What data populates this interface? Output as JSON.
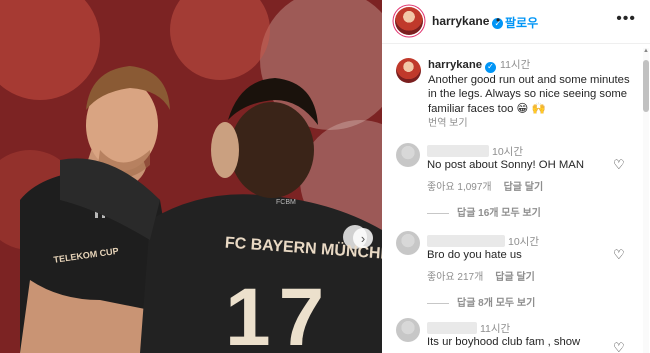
{
  "post": {
    "username": "harrykane",
    "follow_label": "팔로우",
    "more_label": "•••",
    "caption": {
      "username": "harrykane",
      "time": "11시간",
      "text": "Another good run out and some minutes in the legs. Always so nice seeing some familiar faces too 😁 🙌",
      "translate_label": "번역 보기"
    },
    "photo": {
      "jersey_text": "FC BAYERN MÜNCHEN",
      "jersey_number": "17",
      "sleeve_text": "TELEKOM CUP",
      "badge_text": "FCBM"
    }
  },
  "comments": [
    {
      "time": "10시간",
      "text": "No post about Sonny! OH MAN",
      "likes": "좋아요 1,097개",
      "reply_label": "답글 달기",
      "view_replies": "답글 16개 모두 보기"
    },
    {
      "time": "10시간",
      "text": "Bro do you hate us",
      "likes": "좋아요 217개",
      "reply_label": "답글 달기",
      "view_replies": "답글 8개 모두 보기"
    },
    {
      "time": "11시간",
      "text": "Its ur boyhood club fam , show"
    }
  ],
  "icons": {
    "verified": "verified-badge-icon",
    "heart": "heart-outline-icon",
    "next": "chevron-right-icon"
  },
  "colors": {
    "accent": "#0095f6",
    "muted_text": "#8e8e8e",
    "bayern_red": "#c0392b"
  }
}
